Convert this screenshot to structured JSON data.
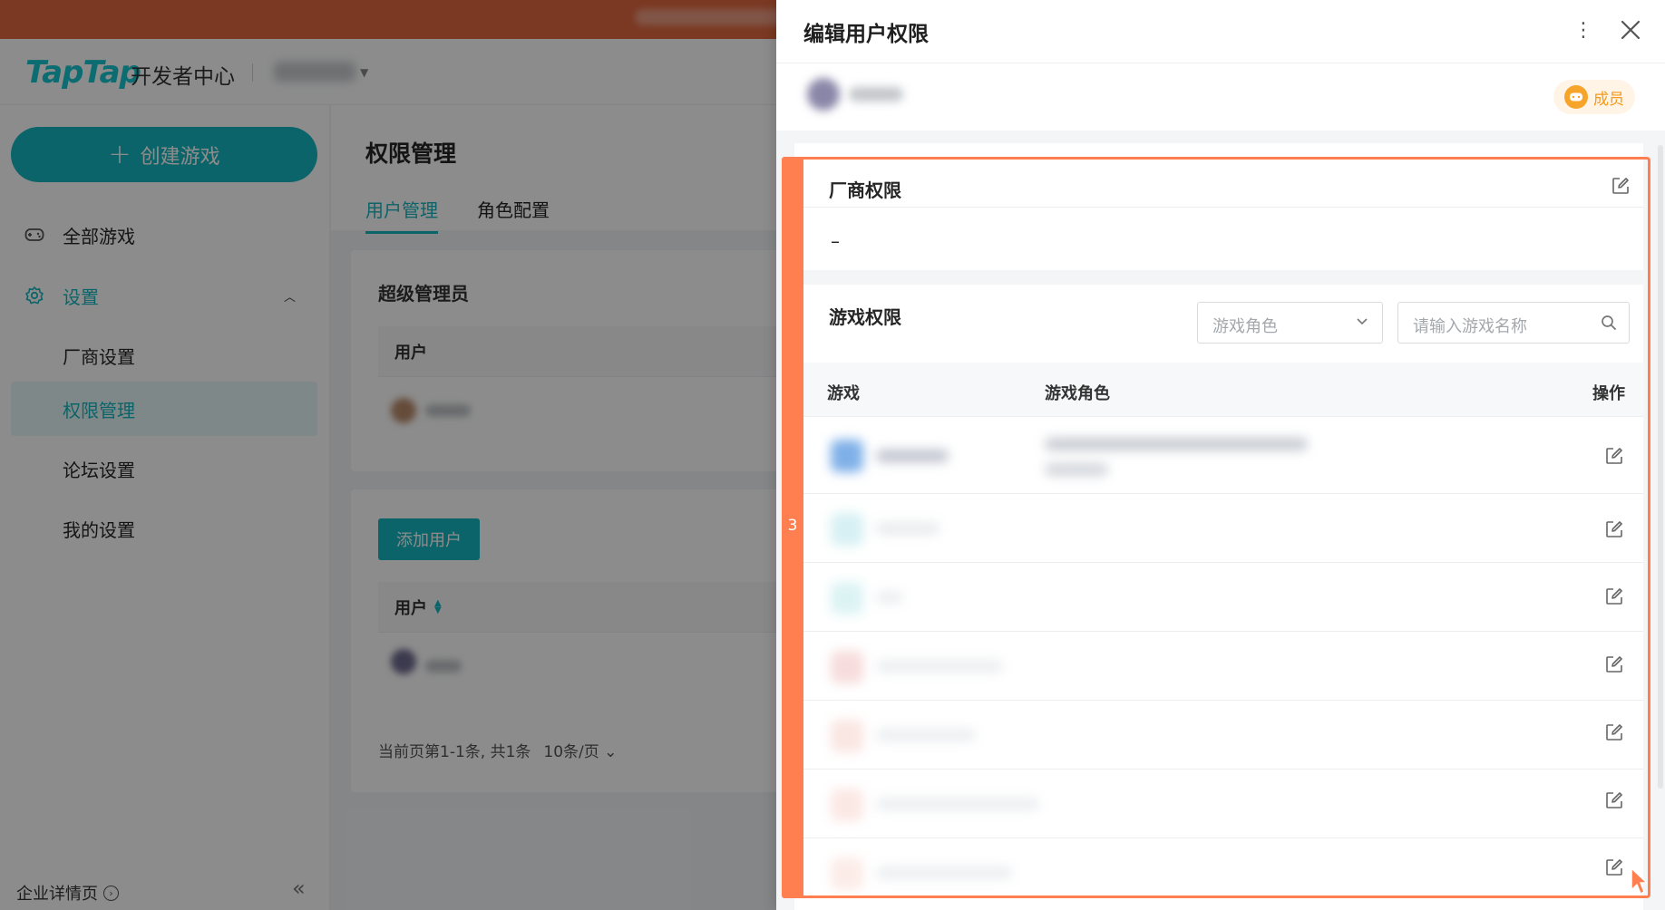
{
  "background": {
    "logo_text": "TapTap",
    "logo_subtitle": "开发者中心",
    "create_button": "创建游戏",
    "nav": {
      "all_games": "全部游戏",
      "settings": "设置",
      "vendor_settings": "厂商设置",
      "permission_management": "权限管理",
      "forum_settings": "论坛设置",
      "my_settings": "我的设置"
    },
    "footer_link": "企业详情页",
    "page_title": "权限管理",
    "tabs": [
      "用户管理",
      "角色配置"
    ],
    "super_admin_title": "超级管理员",
    "user_column": "用户",
    "add_user_button": "添加用户",
    "pager_text": "当前页第1-1条, 共1条",
    "page_size": "10条/页"
  },
  "drawer": {
    "title": "编辑用户权限",
    "member_badge": "成员",
    "vendor_section_title": "厂商权限",
    "vendor_value": "–",
    "game_section_title": "游戏权限",
    "role_select_placeholder": "游戏角色",
    "game_search_placeholder": "请输入游戏名称",
    "table_headers": {
      "game": "游戏",
      "role": "游戏角色",
      "action": "操作"
    },
    "row_count": 7
  },
  "annotation": {
    "label": "3",
    "color": "#ff7f50"
  },
  "colors": {
    "accent": "#15b7bf",
    "banner": "#e0673f",
    "badge": "#f59a1b"
  }
}
